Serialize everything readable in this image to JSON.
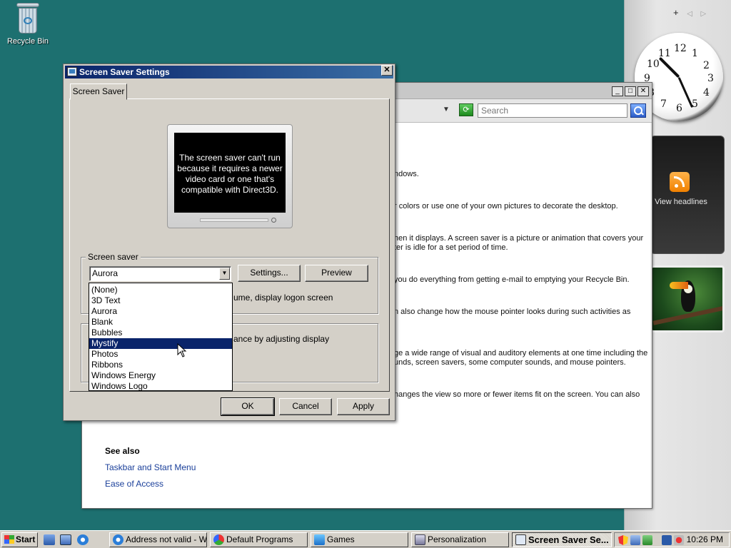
{
  "desktop": {
    "recycle_bin_label": "Recycle Bin"
  },
  "sidebar": {
    "controls": {
      "add": "+",
      "prev": "◁",
      "next": "▷"
    },
    "clock": {
      "numbers": [
        "12",
        "1",
        "2",
        "3",
        "4",
        "5",
        "6",
        "7",
        "8",
        "9",
        "10",
        "11"
      ]
    },
    "feed": {
      "label": "View headlines"
    }
  },
  "cp_window": {
    "search_placeholder": "Search",
    "lines": [
      "ndows.",
      "r colors or use one of your own pictures to decorate the desktop.",
      "hen it displays. A screen saver is a picture or animation that covers your",
      "ter is idle for a set period of time.",
      " you do everything from getting e-mail to emptying your Recycle Bin.",
      "n also change how the mouse pointer looks during such activities as",
      "ge a wide range of visual and auditory elements at one time including the",
      "unds, screen savers, some computer sounds, and mouse pointers.",
      "hanges the view so more or fewer items fit on the screen. You can also"
    ],
    "see_also_label": "See also",
    "links": [
      "Taskbar and Start Menu",
      "Ease of Access"
    ]
  },
  "dialog": {
    "title": "Screen Saver Settings",
    "close_label": "✕",
    "tab_label": "Screen Saver",
    "monitor_message": "The screen saver can't run because it requires a newer video card or one that's compatible with Direct3D.",
    "screensaver_group": {
      "legend": "Screen saver",
      "selected": "Aurora",
      "settings_button": "Settings...",
      "preview_button": "Preview",
      "resume_text": "ume, display logon screen"
    },
    "power_text": "ance by adjusting display",
    "options": [
      "(None)",
      "3D Text",
      "Aurora",
      "Blank",
      "Bubbles",
      "Mystify",
      "Photos",
      "Ribbons",
      "Windows Energy",
      "Windows Logo"
    ],
    "highlighted_option": "Mystify",
    "ok_button": "OK",
    "cancel_button": "Cancel",
    "apply_button": "Apply"
  },
  "taskbar": {
    "start_label": "Start",
    "tasks": [
      "Address not valid - W...",
      "Default Programs",
      "Games",
      "Personalization",
      "Screen Saver Se..."
    ],
    "time": "10:26 PM"
  },
  "colors": {
    "desktop": "#1d7070",
    "dialog_title": "#0a246a",
    "selection": "#0a246a",
    "link": "#1a3f9a"
  }
}
